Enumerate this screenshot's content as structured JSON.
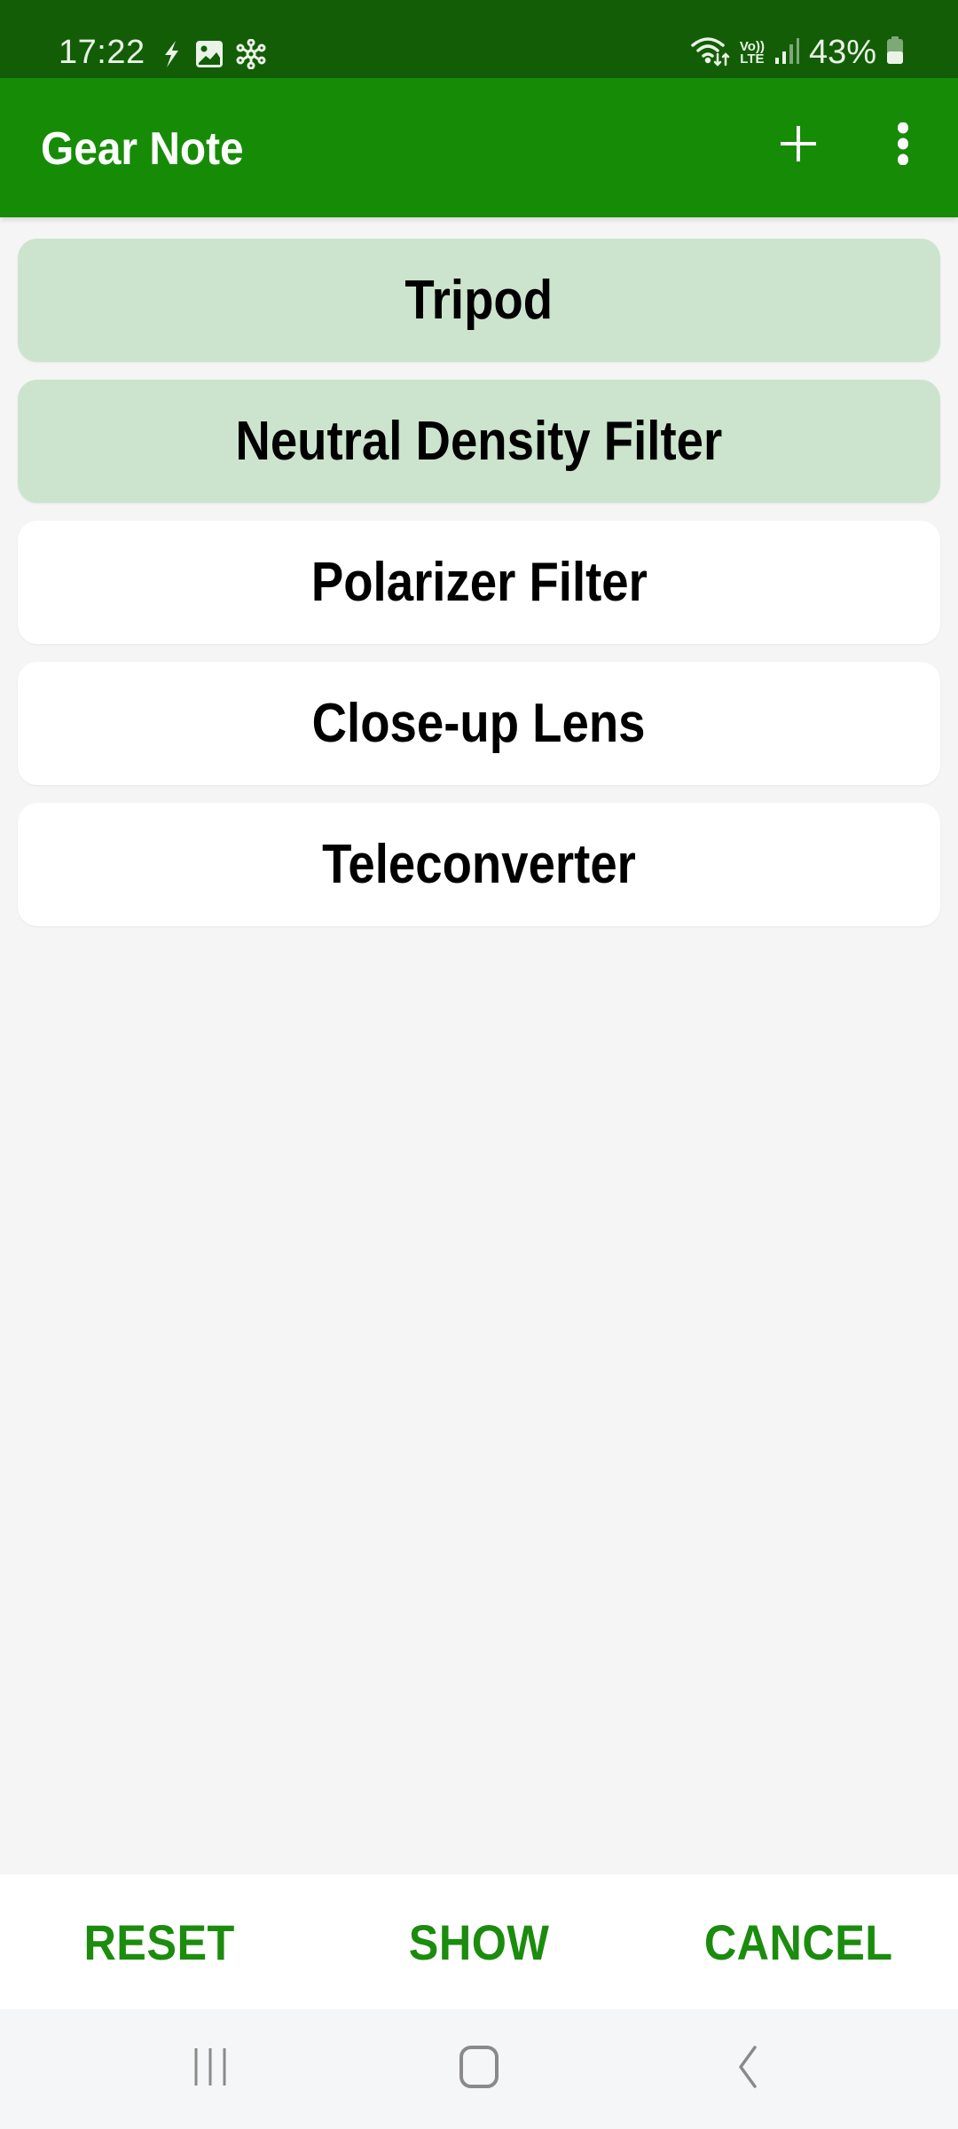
{
  "status_bar": {
    "time": "17:22",
    "left_icons": [
      "flash-icon",
      "image-icon",
      "network-hub-icon"
    ],
    "right_icons": [
      "wifi-icon",
      "volte-icon",
      "signal-icon",
      "battery-icon"
    ],
    "volte_top": "Vo))",
    "volte_bottom": "LTE",
    "battery_percent": "43%",
    "battery_level": 0.43
  },
  "toolbar": {
    "title": "Gear Note",
    "add_icon": "plus-icon",
    "more_icon": "more-vert-icon"
  },
  "gear_list": {
    "items": [
      {
        "label": "Tripod",
        "selected": true
      },
      {
        "label": "Neutral Density Filter",
        "selected": true
      },
      {
        "label": "Polarizer Filter",
        "selected": false
      },
      {
        "label": "Close-up Lens",
        "selected": false
      },
      {
        "label": "Teleconverter",
        "selected": false
      }
    ]
  },
  "actions": {
    "reset": "RESET",
    "show": "SHOW",
    "cancel": "CANCEL"
  },
  "nav": {
    "recents": "recents-icon",
    "home": "home-icon",
    "back": "back-icon"
  },
  "colors": {
    "status_bar": "#135d07",
    "toolbar": "#168c06",
    "accent": "#1b8c0d",
    "selected_card": "#cce4cd",
    "card": "#ffffff",
    "background": "#f5f5f5"
  }
}
